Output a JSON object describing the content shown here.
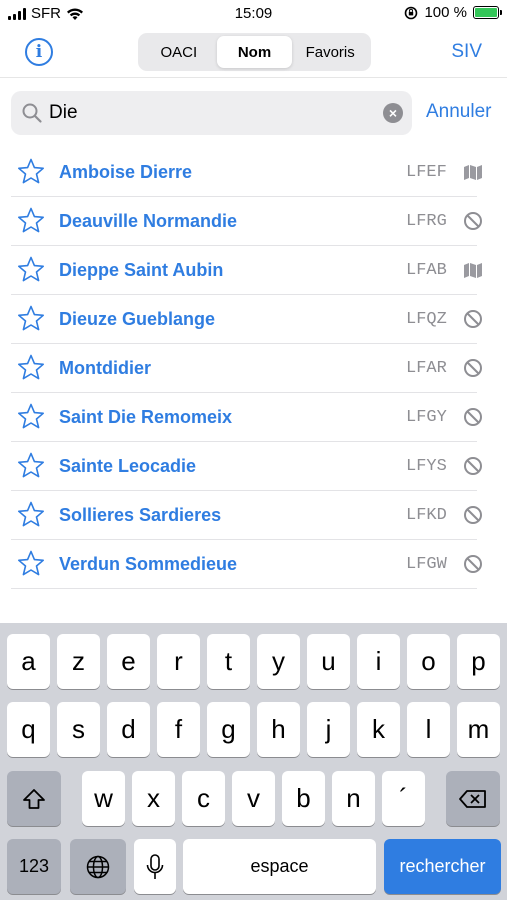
{
  "status_bar": {
    "carrier": "SFR",
    "time": "15:09",
    "battery_text": "100 %",
    "battery_level": 1.0
  },
  "nav": {
    "info_icon": "info-circle-icon",
    "segments": [
      {
        "label": "OACI",
        "active": false
      },
      {
        "label": "Nom",
        "active": true
      },
      {
        "label": "Favoris",
        "active": false
      }
    ],
    "right_button": "SIV"
  },
  "search": {
    "value": "Die",
    "cancel_label": "Annuler"
  },
  "colors": {
    "accent": "#2f7de1",
    "secondary": "#8e8e93",
    "keyboard_bg": "#d1d3d9",
    "battery": "#34c759"
  },
  "results": [
    {
      "name": "Amboise Dierre",
      "code": "LFEF",
      "status_icon": "map-icon"
    },
    {
      "name": "Deauville Normandie",
      "code": "LFRG",
      "status_icon": "prohibited-icon"
    },
    {
      "name": "Dieppe Saint Aubin",
      "code": "LFAB",
      "status_icon": "map-icon"
    },
    {
      "name": "Dieuze Gueblange",
      "code": "LFQZ",
      "status_icon": "prohibited-icon"
    },
    {
      "name": "Montdidier",
      "code": "LFAR",
      "status_icon": "prohibited-icon"
    },
    {
      "name": "Saint Die Remomeix",
      "code": "LFGY",
      "status_icon": "prohibited-icon"
    },
    {
      "name": "Sainte Leocadie",
      "code": "LFYS",
      "status_icon": "prohibited-icon"
    },
    {
      "name": "Sollieres Sardieres",
      "code": "LFKD",
      "status_icon": "prohibited-icon"
    },
    {
      "name": "Verdun Sommedieue",
      "code": "LFGW",
      "status_icon": "prohibited-icon"
    }
  ],
  "keyboard": {
    "row1": [
      "a",
      "z",
      "e",
      "r",
      "t",
      "y",
      "u",
      "i",
      "o",
      "p"
    ],
    "row2": [
      "q",
      "s",
      "d",
      "f",
      "g",
      "h",
      "j",
      "k",
      "l",
      "m"
    ],
    "row3": [
      "w",
      "x",
      "c",
      "v",
      "b",
      "n",
      "´"
    ],
    "numbers_key": "123",
    "space_key": "espace",
    "return_key": "rechercher"
  }
}
